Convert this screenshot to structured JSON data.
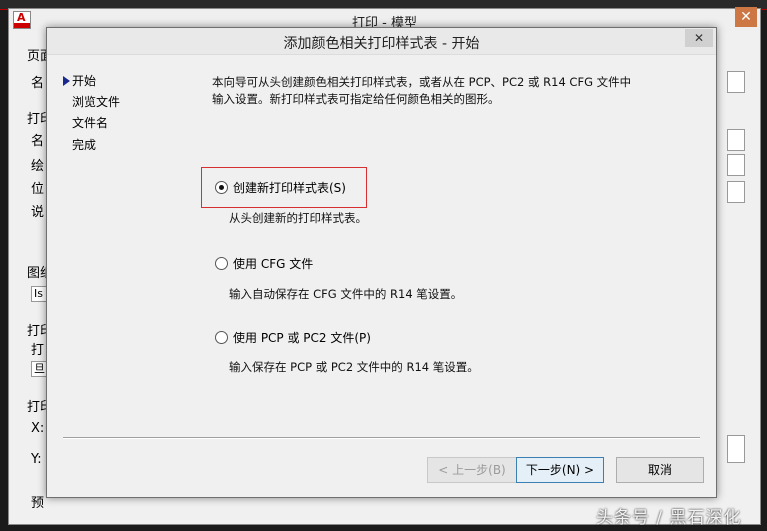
{
  "outer_dialog": {
    "title": "打印 - 模型",
    "close_label": "✕",
    "side_fragments": [
      "页面",
      "名",
      "打印",
      "名",
      "绘",
      "位",
      "说",
      "图纸",
      "打印",
      "打",
      "打印",
      "X:",
      "Y:",
      "预"
    ],
    "box_fragments": [
      "Is",
      "旦"
    ]
  },
  "wizard": {
    "title": "添加颜色相关打印样式表 - 开始",
    "close_label": "✕",
    "steps": [
      "开始",
      "浏览文件",
      "文件名",
      "完成"
    ],
    "current_step": "开始",
    "description": "本向导可从头创建颜色相关打印样式表，或者从在 PCP、PC2 或 R14 CFG 文件中输入设置。新打印样式表可指定给任何颜色相关的图形。",
    "options": [
      {
        "label": "创建新打印样式表(S)",
        "subtext": "从头创建新的打印样式表。",
        "selected": true
      },
      {
        "label": "使用 CFG 文件",
        "subtext": "输入自动保存在 CFG 文件中的 R14 笔设置。",
        "selected": false
      },
      {
        "label": "使用 PCP 或 PC2 文件(P)",
        "subtext": "输入保存在 PCP 或 PC2 文件中的 R14 笔设置。",
        "selected": false
      }
    ],
    "buttons": {
      "back": "< 上一步(B)",
      "next": "下一步(N) >",
      "cancel": "取消"
    }
  },
  "watermark": "头条号 / 黑石深化",
  "colors": {
    "accent": "#3c7fb1",
    "highlight_border": "#d83030",
    "app_icon_red": "#cc0000"
  }
}
